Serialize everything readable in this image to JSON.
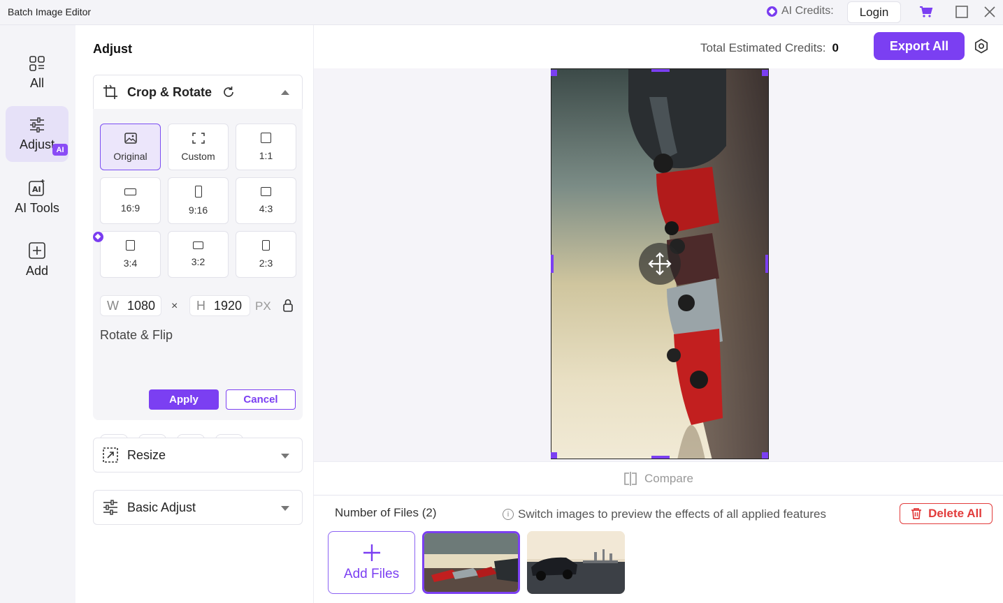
{
  "app": {
    "title": "Batch Image Editor"
  },
  "titlebar": {
    "ai_credits_label": "AI Credits:",
    "login_label": "Login",
    "icons": [
      "ai-credits-icon",
      "cart-icon",
      "maximize-icon",
      "close-icon"
    ]
  },
  "rail": {
    "items": [
      {
        "label": "All",
        "icon": "grid-icon",
        "active": false
      },
      {
        "label": "Adjust",
        "icon": "sliders-icon",
        "active": true
      },
      {
        "label": "AI Tools",
        "icon": "ai-tools-icon",
        "active": false,
        "badge": "AI"
      },
      {
        "label": "Add",
        "icon": "plus-square-icon",
        "active": false
      }
    ]
  },
  "panel": {
    "title": "Adjust",
    "crop": {
      "title": "Crop & Rotate",
      "ratios": [
        {
          "label": "Original",
          "selected": true
        },
        {
          "label": "Custom"
        },
        {
          "label": "1:1"
        },
        {
          "label": "16:9"
        },
        {
          "label": "9:16"
        },
        {
          "label": "4:3"
        },
        {
          "label": "3:4"
        },
        {
          "label": "3:2"
        },
        {
          "label": "2:3"
        }
      ],
      "width_prefix": "W",
      "width_value": "1080",
      "times": "×",
      "height_prefix": "H",
      "height_value": "1920",
      "unit": "PX",
      "rotate_flip_title": "Rotate & Flip",
      "apply_label": "Apply",
      "cancel_label": "Cancel"
    },
    "resize_title": "Resize",
    "basic_adjust_title": "Basic Adjust"
  },
  "topbar": {
    "total_credits_label": "Total Estimated Credits:",
    "total_credits_value": "0",
    "export_label": "Export All"
  },
  "canvas": {
    "compare_label": "Compare"
  },
  "files": {
    "count_label": "Number of Files (2)",
    "hint": "Switch images to preview the effects of all applied features",
    "delete_label": "Delete All",
    "add_label": "Add Files"
  },
  "colors": {
    "accent": "#7b3ff2",
    "danger": "#e23b3b",
    "selected_bg": "#ece6fb"
  }
}
